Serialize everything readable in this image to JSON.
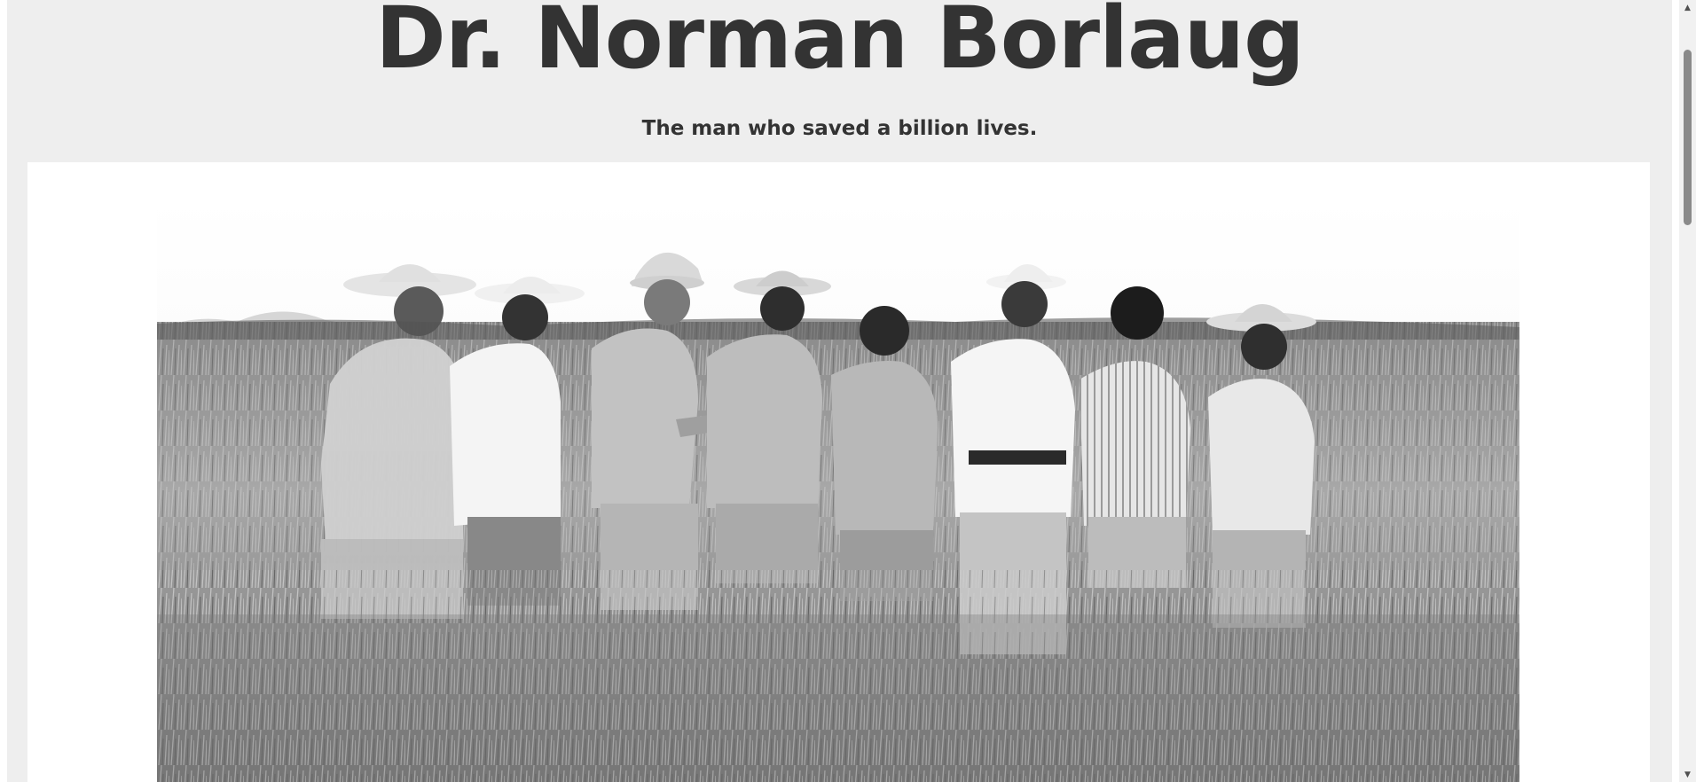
{
  "page": {
    "title": "Dr. Norman Borlaug",
    "subtitle": "The man who saved a billion lives."
  },
  "image": {
    "alt": "Norman Borlaug and colleagues in a wheat field",
    "style": "black-and-white photograph"
  },
  "scrollbar": {
    "up_icon": "triangle-up",
    "down_icon": "triangle-down"
  },
  "colors": {
    "page_background": "#eeeeee",
    "text": "#333333",
    "image_panel": "#ffffff"
  }
}
